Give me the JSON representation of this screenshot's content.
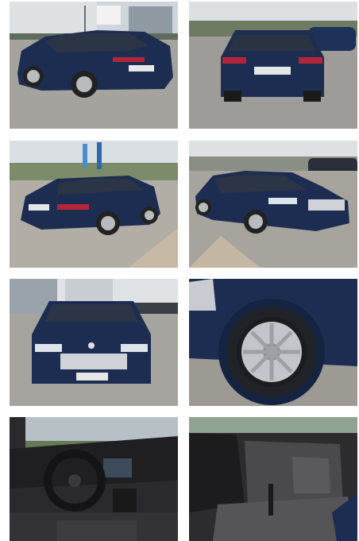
{
  "gallery": {
    "photos": [
      {
        "label": "rear-left-three-quarter"
      },
      {
        "label": "rear"
      },
      {
        "label": "rear-left-angle"
      },
      {
        "label": "front-left-three-quarter"
      },
      {
        "label": "front"
      },
      {
        "label": "front-wheel"
      },
      {
        "label": "dashboard-interior"
      },
      {
        "label": "rear-seats"
      }
    ]
  },
  "colors": {
    "car_body": "#1d2d52",
    "sky": "#d9dde2",
    "pavement": "#9a9893",
    "interior": "#2a2a2c"
  }
}
